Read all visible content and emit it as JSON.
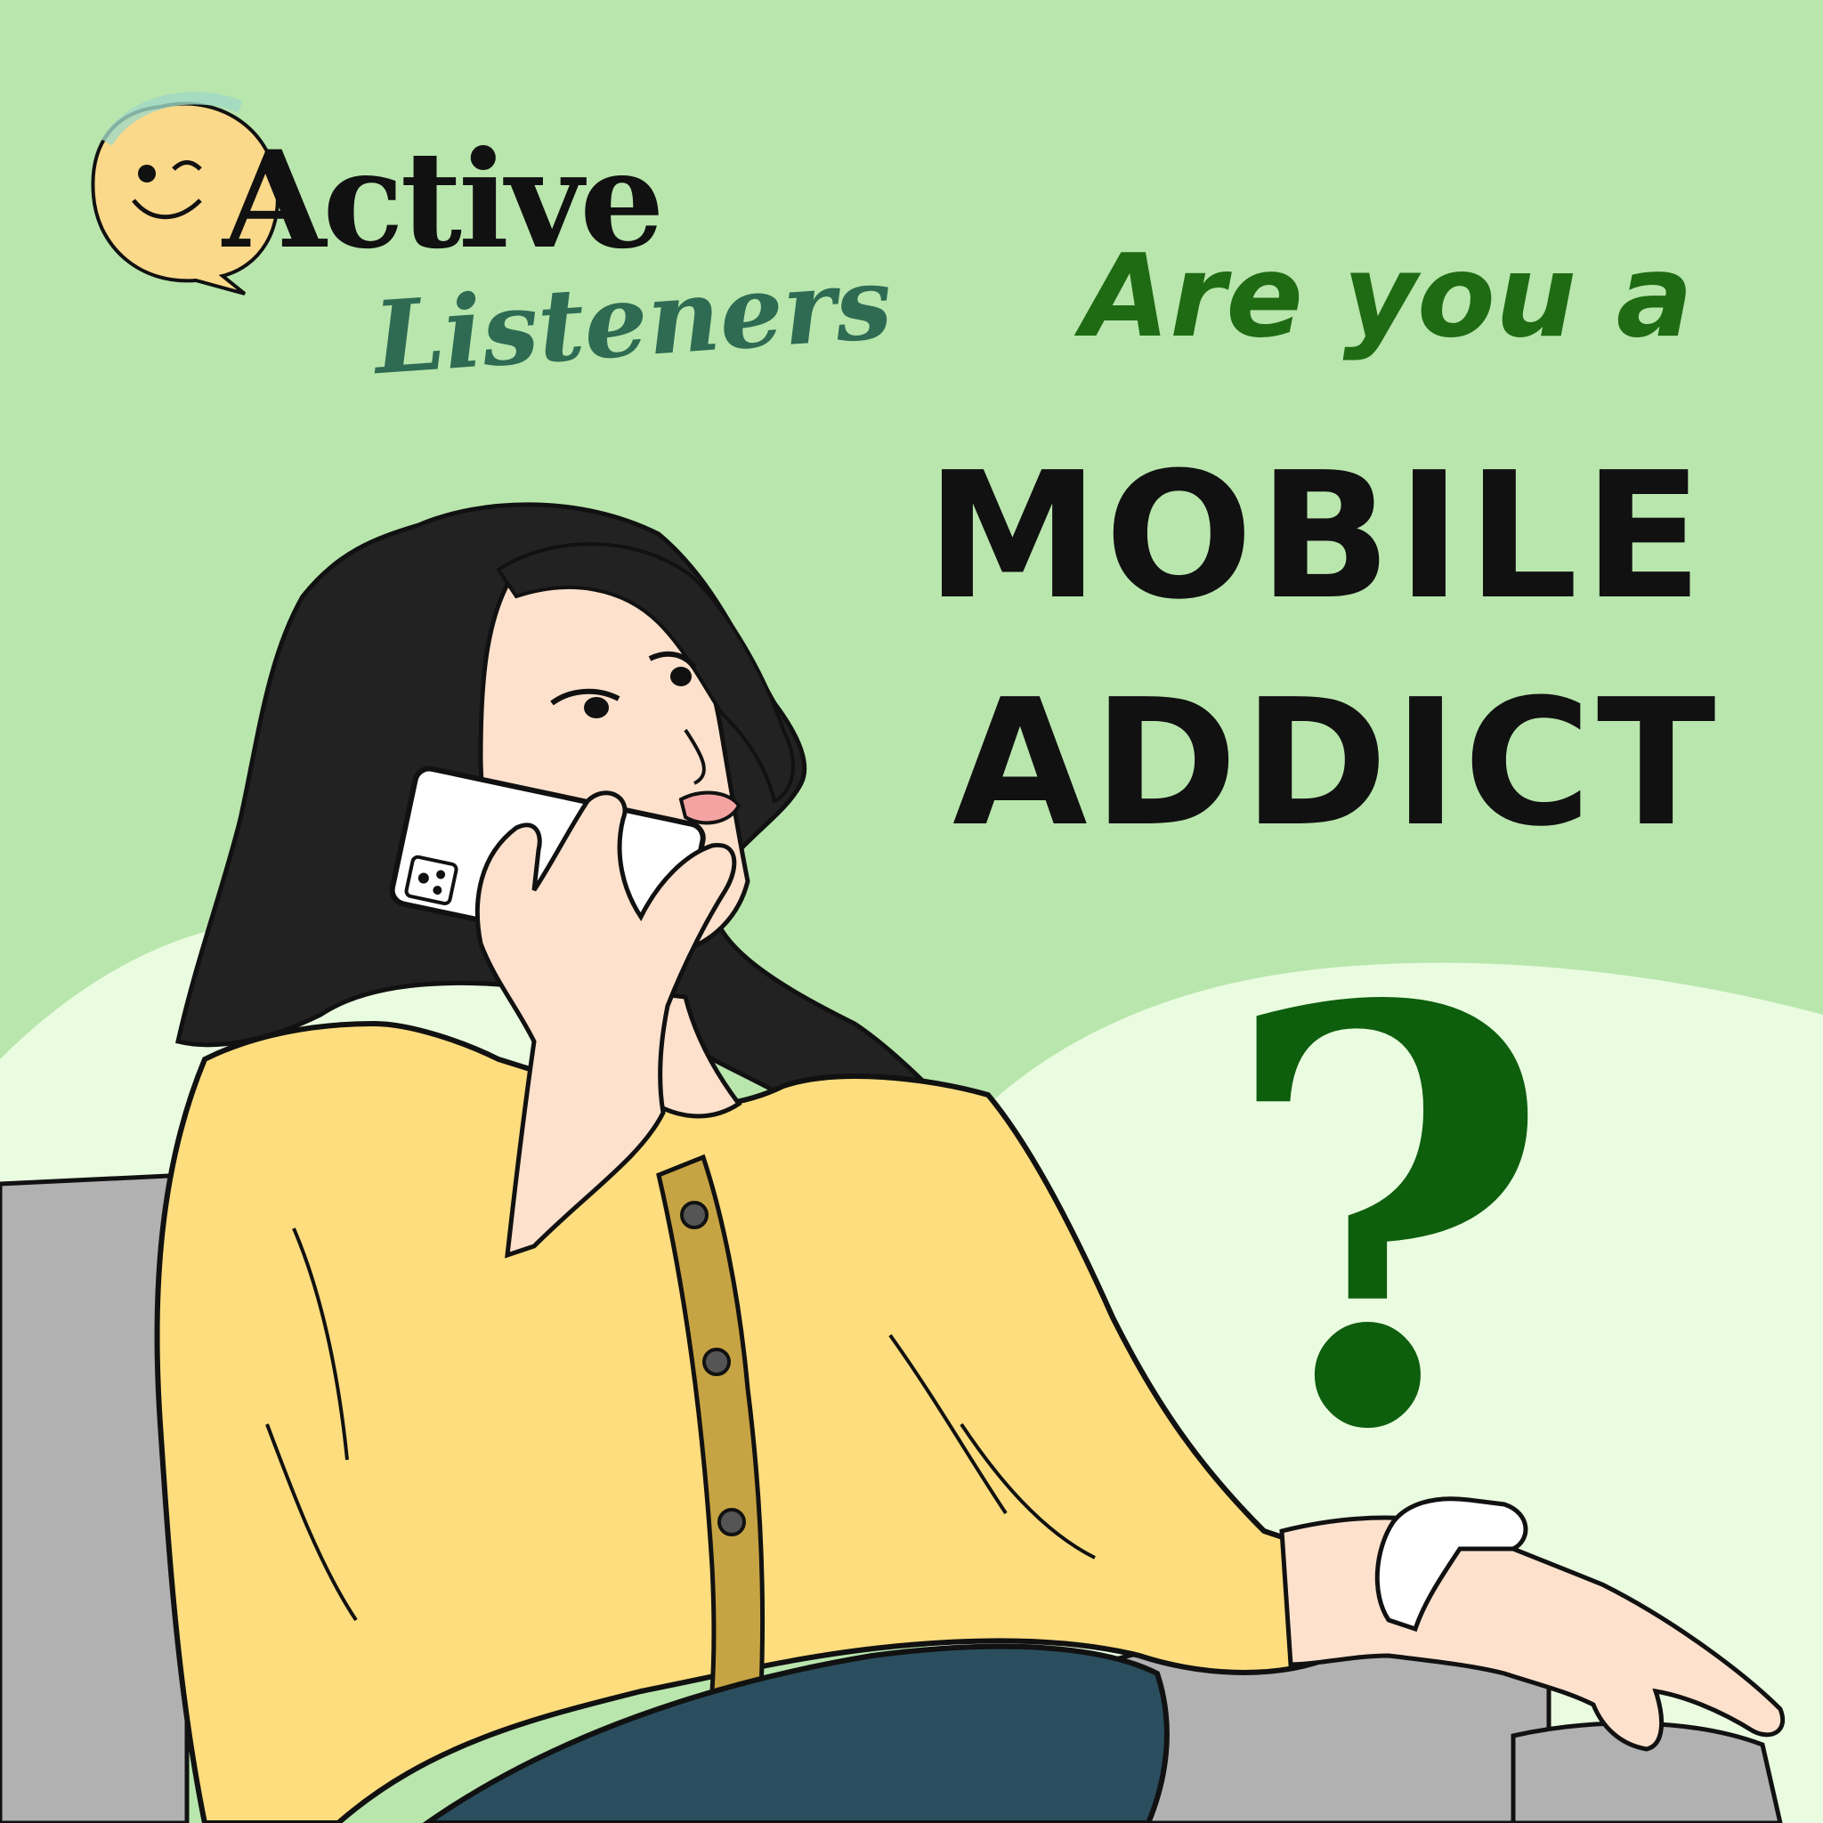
{
  "brand": {
    "name_line1": "Active",
    "name_line2": "Listeners",
    "icon": "winking-smiley-speech-bubble-icon"
  },
  "headline": {
    "line1": "Are you a",
    "line2": "MOBILE",
    "line3": "ADDICT",
    "mark": "?"
  },
  "colors": {
    "background_top": "#b9e6ad",
    "background_hill": "#eafce0",
    "brand_green": "#2e6b52",
    "headline_green": "#1f6b14",
    "question_mark": "#0d5e0d",
    "shirt_yellow": "#fddd7e",
    "placket_mustard": "#c7a443",
    "hair": "#222222",
    "skin": "#fde1cc",
    "pants": "#2a4e5e",
    "couch_gray": "#b1b1b1"
  },
  "illustration": {
    "subject": "woman-on-phone-illustration",
    "phone_icon": "smartphone-icon",
    "watch_icon": "wristwatch-icon"
  }
}
